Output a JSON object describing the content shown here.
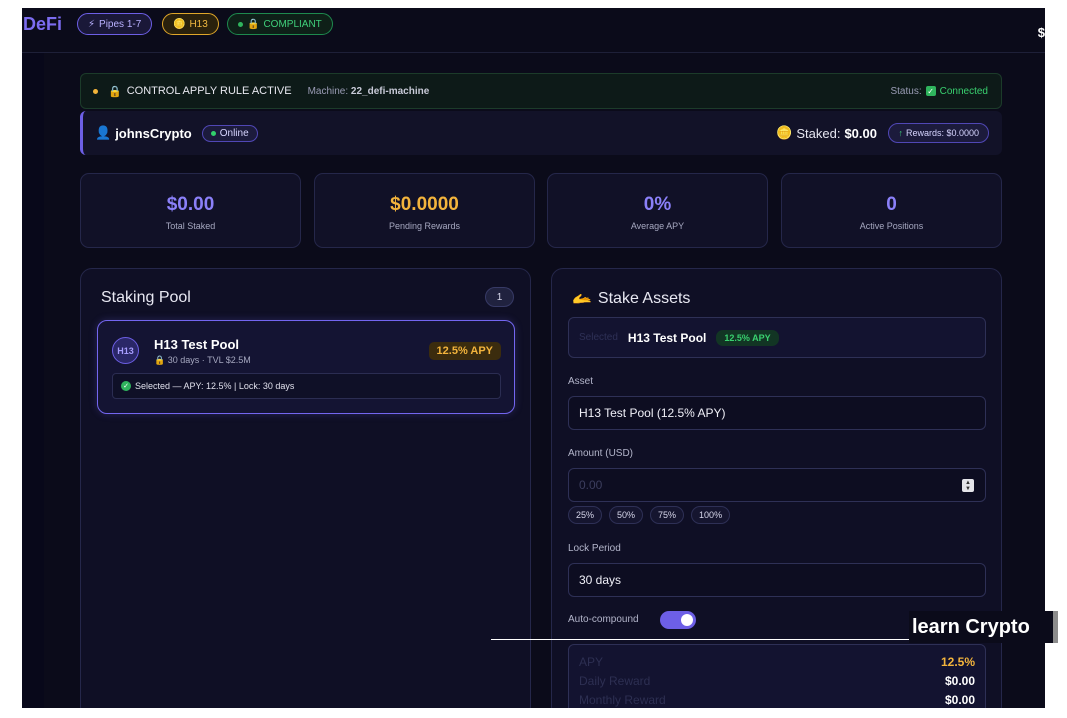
{
  "header": {
    "brand": "DeFi",
    "chips": {
      "pipes": "Pipes 1-7",
      "h13": "H13",
      "compliant": "COMPLIANT"
    },
    "right_text": "$"
  },
  "rule_bar": {
    "text": "CONTROL APPLY RULE ACTIVE",
    "machine_label": "Machine:",
    "machine_value": "22_defi-machine",
    "status_label": "Status:",
    "status_value": "Connected"
  },
  "user_bar": {
    "username": "johnsCrypto",
    "online": "Online",
    "staked_label": "Staked:",
    "staked_value": "$0.00",
    "rewards": "Rewards: $0.0000"
  },
  "stats": [
    {
      "value": "$0.00",
      "label": "Total Staked",
      "color": "#8b80f9"
    },
    {
      "value": "$0.0000",
      "label": "Pending Rewards",
      "color": "#f3b43c"
    },
    {
      "value": "0%",
      "label": "Average APY",
      "color": "#8b80f9"
    },
    {
      "value": "0",
      "label": "Active Positions",
      "color": "#8b80f9"
    }
  ],
  "pool_panel": {
    "title": "Staking Pool",
    "count": "1",
    "pool": {
      "logo": "H13",
      "name": "H13 Test Pool",
      "meta": "30 days · TVL $2.5M",
      "apy": "12.5% APY",
      "selected_text": "Selected — APY: 12.5% | Lock: 30 days"
    }
  },
  "stake_panel": {
    "title": "Stake Assets",
    "selected_faint": "Selected",
    "selected_name": "H13 Test Pool",
    "selected_apy": "12.5% APY",
    "asset_label": "Asset",
    "asset_value": "H13 Test Pool (12.5% APY)",
    "amount_label": "Amount (USD)",
    "amount_placeholder": "0.00",
    "percents": [
      "25%",
      "50%",
      "75%",
      "100%"
    ],
    "lock_label": "Lock Period",
    "lock_value": "30 days",
    "auto_compound_label": "Auto-compound",
    "auto_compound_on": true,
    "summary": {
      "apy_label": "APY",
      "apy_value": "12.5%",
      "daily_label": "Daily Reward",
      "daily_value": "$0.00",
      "monthly_label": "Monthly Reward",
      "monthly_value": "$0.00"
    }
  },
  "overlay": {
    "label": "learn Crypto"
  }
}
